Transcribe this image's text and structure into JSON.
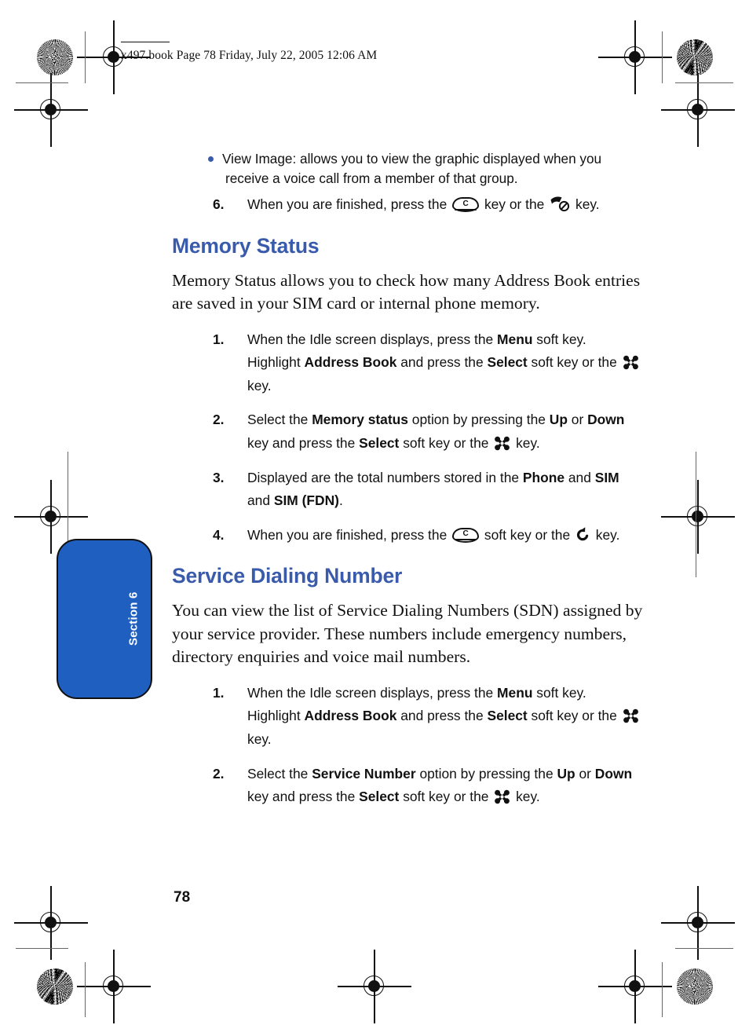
{
  "running_head": "x497.book  Page 78  Friday, July 22, 2005  12:06 AM",
  "folio": "78",
  "thumb_tab": {
    "label": "Section 6",
    "color": "#1f5fc0"
  },
  "accent_color": "#3a5bab",
  "bullet": {
    "line1": "View Image: allows you to view the graphic displayed when you",
    "line2": "receive a voice call from a member of that group."
  },
  "step6": {
    "num": "6.",
    "a": "When you are finished, press the",
    "b": "key or the",
    "c": "key."
  },
  "sections": [
    {
      "heading": "Memory Status",
      "paragraph": "Memory Status allows you to check how many Address Book entries are saved in your SIM card or internal phone memory.",
      "steps": [
        {
          "num": "1.",
          "parts": [
            {
              "t": "When the Idle screen displays, press the ",
              "bold": false
            },
            {
              "t": "Menu",
              "bold": true
            },
            {
              "t": " soft key. Highlight ",
              "bold": false
            },
            {
              "t": "Address Book",
              "bold": true
            },
            {
              "t": " and press the ",
              "bold": false
            },
            {
              "t": "Select",
              "bold": true
            },
            {
              "t": " soft key or the ",
              "bold": false
            },
            {
              "t": "ICON:ok",
              "bold": false
            },
            {
              "t": " key.",
              "bold": false
            }
          ]
        },
        {
          "num": "2.",
          "parts": [
            {
              "t": "Select the ",
              "bold": false
            },
            {
              "t": "Memory status",
              "bold": true
            },
            {
              "t": " option by pressing the ",
              "bold": false
            },
            {
              "t": "Up",
              "bold": true
            },
            {
              "t": " or ",
              "bold": false
            },
            {
              "t": "Down",
              "bold": true
            },
            {
              "t": " key and press the ",
              "bold": false
            },
            {
              "t": "Select",
              "bold": true
            },
            {
              "t": " soft key or the ",
              "bold": false
            },
            {
              "t": "ICON:ok",
              "bold": false
            },
            {
              "t": " key.",
              "bold": false
            }
          ]
        },
        {
          "num": "3.",
          "parts": [
            {
              "t": "Displayed are the total numbers stored in the ",
              "bold": false
            },
            {
              "t": "Phone",
              "bold": true
            },
            {
              "t": " and ",
              "bold": false
            },
            {
              "t": "SIM",
              "bold": true
            },
            {
              "t": " and ",
              "bold": false
            },
            {
              "t": "SIM (FDN)",
              "bold": true
            },
            {
              "t": ".",
              "bold": false
            }
          ]
        },
        {
          "num": "4.",
          "parts": [
            {
              "t": "When you are finished, press the ",
              "bold": false
            },
            {
              "t": "ICON:clear",
              "bold": false
            },
            {
              "t": " soft key or the ",
              "bold": false
            },
            {
              "t": "ICON:back",
              "bold": false
            },
            {
              "t": " key.",
              "bold": false
            }
          ]
        }
      ]
    },
    {
      "heading": "Service Dialing Number",
      "paragraph": "You can view the list of Service Dialing Numbers (SDN) assigned by your service provider. These numbers include emergency numbers, directory enquiries and voice mail numbers.",
      "steps": [
        {
          "num": "1.",
          "parts": [
            {
              "t": "When the Idle screen displays, press the ",
              "bold": false
            },
            {
              "t": "Menu",
              "bold": true
            },
            {
              "t": " soft key. Highlight ",
              "bold": false
            },
            {
              "t": "Address Book",
              "bold": true
            },
            {
              "t": " and press the ",
              "bold": false
            },
            {
              "t": "Select",
              "bold": true
            },
            {
              "t": " soft key or the ",
              "bold": false
            },
            {
              "t": "ICON:ok",
              "bold": false
            },
            {
              "t": " key.",
              "bold": false
            }
          ]
        },
        {
          "num": "2.",
          "parts": [
            {
              "t": "Select the ",
              "bold": false
            },
            {
              "t": "Service Number",
              "bold": true
            },
            {
              "t": " option by pressing the ",
              "bold": false
            },
            {
              "t": "Up",
              "bold": true
            },
            {
              "t": " or ",
              "bold": false
            },
            {
              "t": "Down",
              "bold": true
            },
            {
              "t": " key and press the ",
              "bold": false
            },
            {
              "t": "Select",
              "bold": true
            },
            {
              "t": " soft key or the ",
              "bold": false
            },
            {
              "t": "ICON:ok",
              "bold": false
            },
            {
              "t": " key.",
              "bold": false
            }
          ]
        }
      ]
    }
  ],
  "icons": {
    "ok": "navigation-ok-key-icon",
    "clear": "clear-c-key-icon",
    "back": "back-arrow-key-icon",
    "end": "end-call-key-icon"
  }
}
